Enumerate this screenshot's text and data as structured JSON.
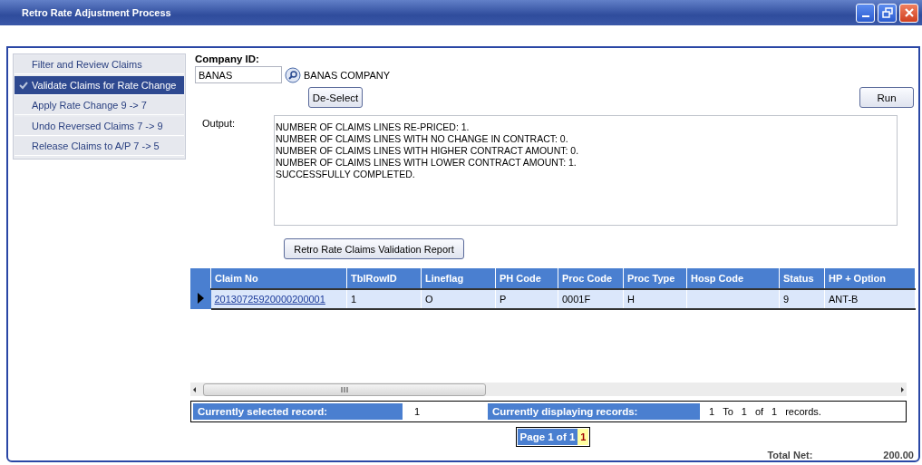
{
  "window": {
    "title": "Retro Rate Adjustment Process"
  },
  "sidebar": {
    "items": [
      {
        "label": "Filter and Review Claims",
        "selected": false
      },
      {
        "label": "Validate Claims for Rate Change",
        "selected": true
      },
      {
        "label": "Apply Rate Change 9 -> 7",
        "selected": false
      },
      {
        "label": "Undo Reversed Claims 7 -> 9",
        "selected": false
      },
      {
        "label": "Release Claims to A/P 7 -> 5",
        "selected": false
      }
    ]
  },
  "company": {
    "label": "Company ID:",
    "value": "BANAS",
    "name": "BANAS COMPANY"
  },
  "buttons": {
    "deselect": "De-Select",
    "run": "Run",
    "report": "Retro Rate Claims Validation Report"
  },
  "output": {
    "label": "Output:",
    "lines": [
      "NUMBER OF CLAIMS LINES RE-PRICED: 1.",
      "NUMBER OF CLAIMS LINES WITH NO CHANGE IN CONTRACT: 0.",
      "NUMBER OF CLAIMS LINES WITH HIGHER CONTRACT AMOUNT: 0.",
      "NUMBER OF CLAIMS LINES WITH LOWER CONTRACT AMOUNT: 1.",
      "SUCCESSFULLY COMPLETED."
    ]
  },
  "table": {
    "columns": [
      "Claim No",
      "TblRowID",
      "Lineflag",
      "PH Code",
      "Proc Code",
      "Proc Type",
      "Hosp Code",
      "Status",
      "HP + Option"
    ],
    "rows": [
      {
        "selected": true,
        "cells": [
          "20130725920000200001",
          "1",
          "O",
          "P",
          "0001F",
          "H",
          "",
          "9",
          "ANT-B"
        ]
      }
    ]
  },
  "records": {
    "selected_label": "Currently selected record:",
    "selected_value": "1",
    "displaying_label": "Currently displaying records:",
    "displaying": [
      "1",
      "To",
      "1",
      "of",
      "1",
      "records."
    ]
  },
  "pager": {
    "label": "Page 1 of 1",
    "pages": [
      {
        "label": "1",
        "selected": true
      }
    ]
  },
  "total": {
    "label": "Total Net:",
    "value": "200.00"
  }
}
